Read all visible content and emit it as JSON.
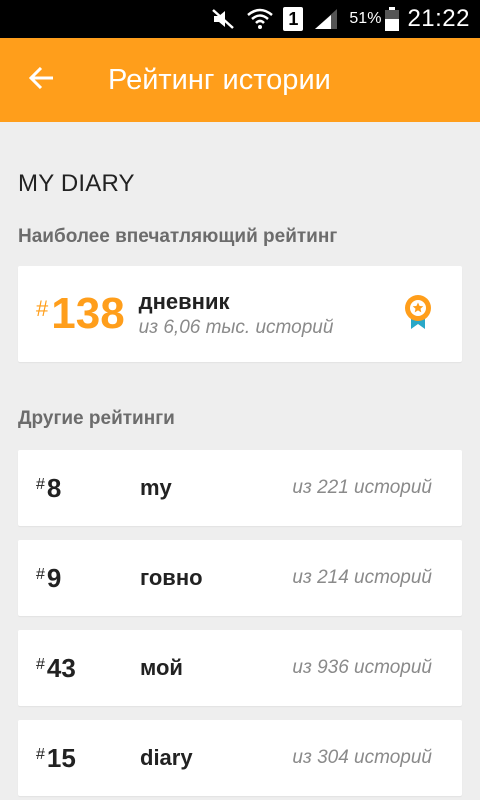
{
  "status_bar": {
    "battery_percent": "51%",
    "time": "21:22",
    "sim_label": "1",
    "icons": [
      "mute-icon",
      "wifi-icon",
      "sim-icon",
      "signal-icon",
      "battery-icon"
    ]
  },
  "app_bar": {
    "title": "Рейтинг истории",
    "back_icon": "arrow-left-icon",
    "color": "#ff9e1b"
  },
  "diary": {
    "title": "MY DIARY"
  },
  "top_rating": {
    "section_label": "Наиболее впечатляющий рейтинг",
    "hash": "#",
    "rank": "138",
    "tag": "дневник",
    "stories": "из 6,06 тыс. историй",
    "icon": "medal-icon",
    "accent": "#ff9e1b",
    "medal_ribbon_color": "#29a8c8"
  },
  "other_ratings": {
    "section_label": "Другие рейтинги",
    "items": [
      {
        "hash": "#",
        "rank": "8",
        "tag": "my",
        "stories": "из 221 историй"
      },
      {
        "hash": "#",
        "rank": "9",
        "tag": "говно",
        "stories": "из 214 историй"
      },
      {
        "hash": "#",
        "rank": "43",
        "tag": "мой",
        "stories": "из 936 историй"
      },
      {
        "hash": "#",
        "rank": "15",
        "tag": "diary",
        "stories": "из 304 историй"
      }
    ]
  }
}
